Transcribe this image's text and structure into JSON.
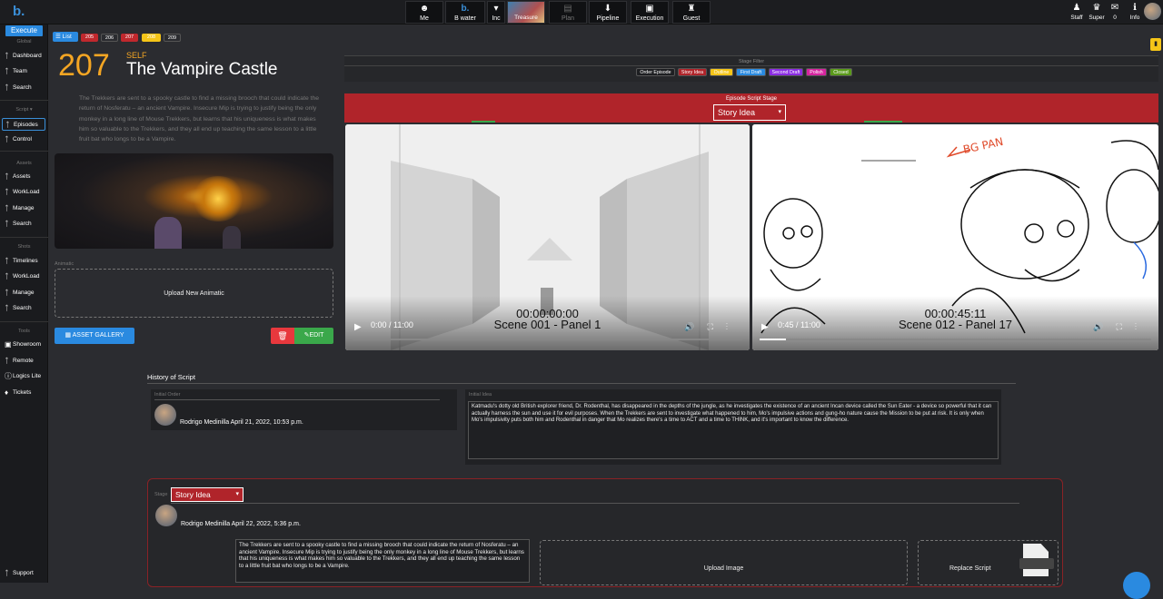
{
  "topbar": {
    "logo": "b.",
    "items": [
      {
        "label": "Me",
        "icon": "user-icon",
        "dim": false
      },
      {
        "label": "B water",
        "icon": "b-logo-icon",
        "dim": false
      },
      {
        "label": "Inc",
        "icon": "dropdown-icon",
        "dim": false
      },
      {
        "label": "Treasure",
        "icon": "thumbnail",
        "dim": false
      },
      {
        "label": "Plan",
        "icon": "map-icon",
        "dim": true
      },
      {
        "label": "Pipeline",
        "icon": "pipeline-icon",
        "dim": false
      },
      {
        "label": "Execution",
        "icon": "camera-icon",
        "dim": false
      },
      {
        "label": "Guest",
        "icon": "guest-icon",
        "dim": false
      }
    ],
    "right": [
      {
        "label": "Staff",
        "icon": "staff-icon"
      },
      {
        "label": "Super",
        "icon": "super-icon"
      },
      {
        "label": "0",
        "icon": "mail-icon"
      },
      {
        "label": "Info",
        "icon": "info-icon"
      }
    ]
  },
  "sidebar": {
    "execute": "Execute",
    "sections": [
      {
        "title": "Global",
        "items": [
          "Dashboard",
          "Team",
          "Search"
        ]
      },
      {
        "title": "Script",
        "items": [
          "Episodes",
          "Control"
        ]
      },
      {
        "title": "Assets",
        "items": [
          "Assets",
          "WorkLoad",
          "Manage",
          "Search"
        ]
      },
      {
        "title": "Shots",
        "items": [
          "Timelines",
          "WorkLoad",
          "Manage",
          "Search"
        ]
      },
      {
        "title": "Tools",
        "items": [
          "Showroom",
          "Remote",
          "Logics Lite",
          "Tickets"
        ]
      }
    ],
    "support": "Support"
  },
  "episodes_bar": {
    "list": "List",
    "tags": [
      {
        "label": "205",
        "color": "#c0282d",
        "text": "#fff"
      },
      {
        "label": "206",
        "color": "#2b2c30",
        "text": "#fff"
      },
      {
        "label": "207",
        "color": "#c0282d",
        "text": "#fff"
      },
      {
        "label": "208",
        "color": "#f5c518",
        "text": "#fff"
      },
      {
        "label": "209",
        "color": "#2b2c30",
        "text": "#fff"
      }
    ]
  },
  "episode": {
    "number": "207",
    "self": "SELF",
    "title": "The Vampire Castle",
    "synopsis": "The Trekkers are sent to a spooky castle to find a missing brooch that could indicate the return of Nosferatu – an ancient Vampire. Insecure Mip is trying to justify being the only monkey in a long line of Mouse Trekkers, but learns that his uniqueness is what makes him so valuable to the Trekkers, and they all end up teaching the same lesson to a little fruit bat who longs to be a Vampire."
  },
  "animatic": {
    "label": "Animatic",
    "upload": "Upload New Animatic"
  },
  "buttons": {
    "gallery": "ASSET GALLERY",
    "edit": "EDIT"
  },
  "stage_filter": {
    "title": "Stage Filter",
    "chips": [
      {
        "label": "Order Episode",
        "color": "#1e1f22"
      },
      {
        "label": "Story Idea",
        "color": "#b0242a"
      },
      {
        "label": "Outline",
        "color": "#f5c518"
      },
      {
        "label": "First Draft",
        "color": "#2a8ae0"
      },
      {
        "label": "Second Draft",
        "color": "#8a2be2"
      },
      {
        "label": "Polish",
        "color": "#d6249f"
      },
      {
        "label": "Closed",
        "color": "#5a9a1a"
      }
    ]
  },
  "script_stage": {
    "title": "Episode Script Stage",
    "value": "Story Idea"
  },
  "videos": [
    {
      "time": "0:00 / 11:00",
      "overlay_time": "00:00:00:00",
      "overlay_scene": "Scene 001 - Panel 1",
      "progress": 0
    },
    {
      "time": "0:45 / 11:00",
      "overlay_time": "00:00:45:11",
      "overlay_scene": "Scene 012 - Panel 17",
      "progress": 0.068,
      "annotation": "BG PAN"
    }
  ],
  "history": {
    "title": "History of Script",
    "initial_order": {
      "label": "Initial Order",
      "author": "Rodrigo Medinilla April 21, 2022, 10:53 p.m."
    },
    "initial_idea": {
      "label": "Initial Idea",
      "text": "Katmadu's dotty old British explorer friend, Dr. Rodenthal, has disappeared in the depths of the jungle, as he investigates the existence of an ancient Incan device called the Sun Eater - a device so powerful that it can actually harness the sun and use it for evil purposes. When the Trekkers are sent to investigate what happened to him, Mo's impulsive actions and gung-ho nature cause the Mission to be put at risk. It is only when Mo's impulsivity puts both him and Rodenthal in danger that Mo realizes there's a time to ACT and a time to THINK, and it's important to know the difference."
    }
  },
  "stage_entry": {
    "label": "Stage",
    "value": "Story Idea",
    "author": "Rodrigo Medinilla April 22, 2022, 5:36 p.m.",
    "text": "The Trekkers are sent to a spooky castle to find a missing brooch that could indicate the return of Nosferatu – an ancient Vampire. Insecure Mip is trying to justify being the only monkey in a long line of Mouse Trekkers, but learns that his uniqueness is what makes him so valuable to the Trekkers, and they all end up teaching the same lesson to a little fruit bat who longs to be a Vampire.",
    "upload_image": "Upload Image",
    "replace_script": "Replace Script"
  }
}
